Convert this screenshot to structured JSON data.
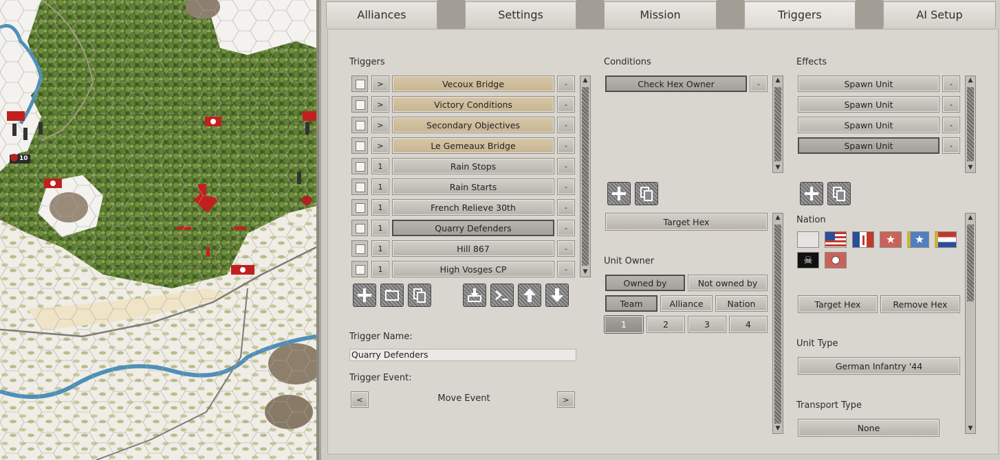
{
  "tabs": [
    {
      "label": "Alliances"
    },
    {
      "label": "Settings"
    },
    {
      "label": "Mission"
    },
    {
      "label": "Triggers"
    },
    {
      "label": "AI Setup"
    }
  ],
  "active_tab": "Triggers",
  "map": {
    "unit_badge_value": "10"
  },
  "triggers": {
    "header": "Triggers",
    "items": [
      {
        "name": "Vecoux Bridge",
        "toggle": ">",
        "remove": "-"
      },
      {
        "name": "Victory Conditions",
        "toggle": ">",
        "remove": "-"
      },
      {
        "name": "Secondary Objectives",
        "toggle": ">",
        "remove": "-"
      },
      {
        "name": "Le Gemeaux Bridge",
        "toggle": ">",
        "remove": "-"
      },
      {
        "name": "Rain Stops",
        "toggle": "1",
        "remove": "-"
      },
      {
        "name": "Rain Starts",
        "toggle": "1",
        "remove": "-"
      },
      {
        "name": "French Relieve 30th",
        "toggle": "1",
        "remove": "-"
      },
      {
        "name": "Quarry Defenders",
        "toggle": "1",
        "remove": "-"
      },
      {
        "name": "Hill 867",
        "toggle": "1",
        "remove": "-"
      },
      {
        "name": "High Vosges CP",
        "toggle": "1",
        "remove": "-"
      }
    ],
    "name_label": "Trigger Name:",
    "name_value": "Quarry Defenders",
    "event_label": "Trigger Event:",
    "event_prev": "<",
    "event_next": ">",
    "event_value": "Move Event"
  },
  "conditions": {
    "header": "Conditions",
    "items": [
      {
        "name": "Check Hex Owner",
        "remove": "-"
      }
    ],
    "target_hex": "Target Hex",
    "unit_owner_label": "Unit Owner",
    "owned_by": "Owned by",
    "not_owned_by": "Not owned by",
    "team": "Team",
    "alliance": "Alliance",
    "nation": "Nation",
    "team_numbers": [
      "1",
      "2",
      "3",
      "4"
    ]
  },
  "effects": {
    "header": "Effects",
    "items": [
      {
        "name": "Spawn Unit",
        "remove": "-"
      },
      {
        "name": "Spawn Unit",
        "remove": "-"
      },
      {
        "name": "Spawn Unit",
        "remove": "-"
      },
      {
        "name": "Spawn Unit",
        "remove": "-"
      }
    ],
    "nation_label": "Nation",
    "target_hex": "Target Hex",
    "remove_hex": "Remove Hex",
    "unit_type_label": "Unit Type",
    "unit_type_value": "German Infantry '44",
    "transport_type_label": "Transport Type",
    "transport_type_value": "None"
  },
  "colors": {
    "panel": "#d9d6d0",
    "tan_button": "#d1bf9d",
    "forest": "#4c6a2a",
    "river": "#4d8fb8"
  }
}
